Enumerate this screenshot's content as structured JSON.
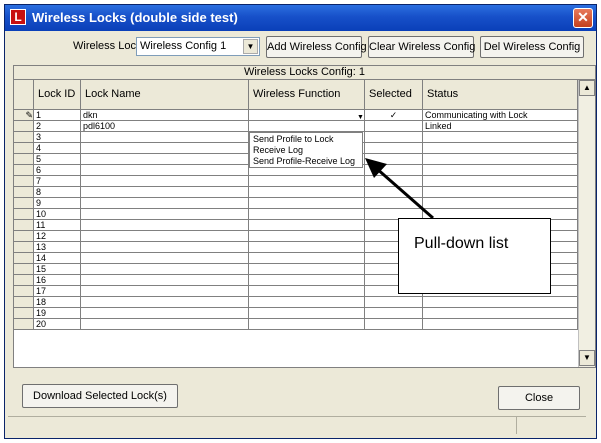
{
  "window": {
    "title": "Wireless Locks (double side test)",
    "app_icon_glyph": "L",
    "close_glyph": "✕"
  },
  "toolbar": {
    "wireless_lock_label": "Wireless Lock",
    "wireless_lock_value": "Wireless Config 1",
    "add_label": "Add Wireless Config",
    "clear_label": "Clear Wireless Config",
    "del_label": "Del Wireless Config"
  },
  "grid": {
    "caption": "Wireless Locks Config: 1",
    "columns": [
      "Lock ID",
      "Lock Name",
      "Wireless Function",
      "Selected",
      "Status"
    ],
    "rows": [
      {
        "id": "1",
        "name": "dkn",
        "function": "",
        "selected": "✓",
        "status": "Communicating with Lock",
        "editing": "✎"
      },
      {
        "id": "2",
        "name": "pdl6100",
        "function": "",
        "selected": "",
        "status": "Linked",
        "editing": ""
      },
      {
        "id": "3",
        "name": "",
        "function": "",
        "selected": "",
        "status": "",
        "editing": ""
      },
      {
        "id": "4",
        "name": "",
        "function": "",
        "selected": "",
        "status": "",
        "editing": ""
      },
      {
        "id": "5",
        "name": "",
        "function": "",
        "selected": "",
        "status": "",
        "editing": ""
      },
      {
        "id": "6",
        "name": "",
        "function": "",
        "selected": "",
        "status": "",
        "editing": ""
      },
      {
        "id": "7",
        "name": "",
        "function": "",
        "selected": "",
        "status": "",
        "editing": ""
      },
      {
        "id": "8",
        "name": "",
        "function": "",
        "selected": "",
        "status": "",
        "editing": ""
      },
      {
        "id": "9",
        "name": "",
        "function": "",
        "selected": "",
        "status": "",
        "editing": ""
      },
      {
        "id": "10",
        "name": "",
        "function": "",
        "selected": "",
        "status": "",
        "editing": ""
      },
      {
        "id": "11",
        "name": "",
        "function": "",
        "selected": "",
        "status": "",
        "editing": ""
      },
      {
        "id": "12",
        "name": "",
        "function": "",
        "selected": "",
        "status": "",
        "editing": ""
      },
      {
        "id": "13",
        "name": "",
        "function": "",
        "selected": "",
        "status": "",
        "editing": ""
      },
      {
        "id": "14",
        "name": "",
        "function": "",
        "selected": "",
        "status": "",
        "editing": ""
      },
      {
        "id": "15",
        "name": "",
        "function": "",
        "selected": "",
        "status": "",
        "editing": ""
      },
      {
        "id": "16",
        "name": "",
        "function": "",
        "selected": "",
        "status": "",
        "editing": ""
      },
      {
        "id": "17",
        "name": "",
        "function": "",
        "selected": "",
        "status": "",
        "editing": ""
      },
      {
        "id": "18",
        "name": "",
        "function": "",
        "selected": "",
        "status": "",
        "editing": ""
      },
      {
        "id": "19",
        "name": "",
        "function": "",
        "selected": "",
        "status": "",
        "editing": ""
      },
      {
        "id": "20",
        "name": "",
        "function": "",
        "selected": "",
        "status": "",
        "editing": ""
      }
    ],
    "dropdown_options": [
      "Send Profile to Lock",
      "Receive Log",
      "Send Profile-Receive Log"
    ]
  },
  "callout": {
    "text": "Pull-down list"
  },
  "footer": {
    "download_label": "Download Selected Lock(s)",
    "close_label": "Close"
  },
  "icons": {
    "dropdown": "▼",
    "scroll_up": "▲",
    "scroll_down": "▼"
  }
}
